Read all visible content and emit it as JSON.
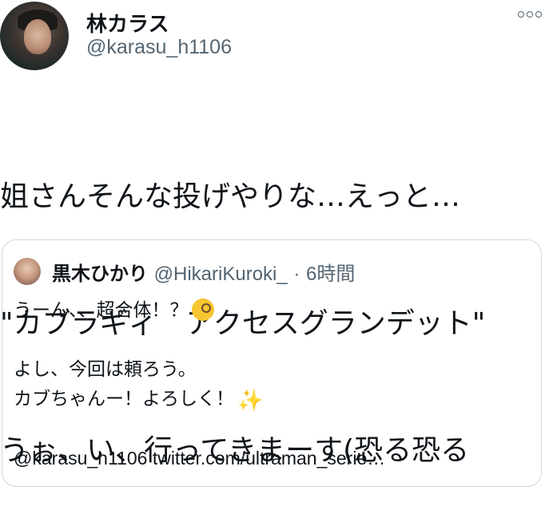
{
  "author": {
    "display_name": "林カラス",
    "handle": "@karasu_h1106",
    "avatar_icon": "profile-photo"
  },
  "more_icon": "ellipsis-icon",
  "tweet": {
    "lines": [
      "姐さんそんな投げやりな…えっと…",
      "\"カブラギィ　アクセスグランデット\"",
      "うぉ、い、行ってきまーす(恐る恐る"
    ]
  },
  "quote": {
    "display_name": "黒木ひかり",
    "handle": "@HikariKuroki_",
    "dot": "·",
    "time": "6時間",
    "lines": [
      "うーん、、超合体！？",
      "",
      "よし、今回は頼ろう。",
      "カブちゃんー！よろしく！",
      "",
      "@karasu_h1106 twitter.com/ultraman_serie…"
    ],
    "emoji": {
      "line0": "face-with-monocle-emoji",
      "line3": "sparkles-emoji",
      "sparkles_glyph": "✨"
    }
  }
}
